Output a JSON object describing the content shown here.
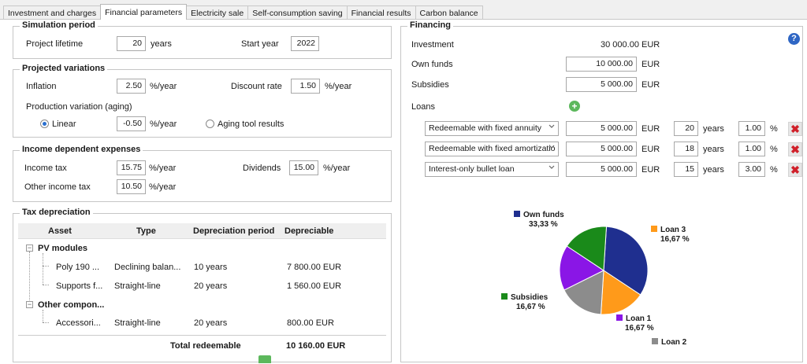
{
  "tabs": [
    {
      "label": "Investment and charges"
    },
    {
      "label": "Financial parameters"
    },
    {
      "label": "Electricity sale"
    },
    {
      "label": "Self-consumption saving"
    },
    {
      "label": "Financial results"
    },
    {
      "label": "Carbon balance"
    }
  ],
  "simulation": {
    "title": "Simulation period",
    "lifetime_label": "Project lifetime",
    "lifetime_value": "20",
    "lifetime_unit": "years",
    "start_label": "Start year",
    "start_value": "2022"
  },
  "variations": {
    "title": "Projected variations",
    "inflation_label": "Inflation",
    "inflation_value": "2.50",
    "inflation_unit": "%/year",
    "discount_label": "Discount rate",
    "discount_value": "1.50",
    "discount_unit": "%/year",
    "production_label": "Production variation (aging)",
    "linear_label": "Linear",
    "linear_value": "-0.50",
    "linear_unit": "%/year",
    "aging_label": "Aging tool results"
  },
  "income": {
    "title": "Income dependent expenses",
    "tax_label": "Income tax",
    "tax_value": "15.75",
    "tax_unit": "%/year",
    "dividends_label": "Dividends",
    "dividends_value": "15.00",
    "dividends_unit": "%/year",
    "other_label": "Other income tax",
    "other_value": "10.50",
    "other_unit": "%/year"
  },
  "depreciation": {
    "title": "Tax depreciation",
    "headers": [
      "Asset",
      "Type",
      "Depreciation period",
      "Depreciable"
    ],
    "group1": "PV modules",
    "row1": {
      "asset": "Poly 190 ...",
      "type": "Declining balan...",
      "period": "10 years",
      "value": "7 800.00 EUR"
    },
    "row2": {
      "asset": "Supports f...",
      "type": "Straight-line",
      "period": "20 years",
      "value": "1 560.00 EUR"
    },
    "group2": "Other compon...",
    "row3": {
      "asset": "Accessori...",
      "type": "Straight-line",
      "period": "20 years",
      "value": "800.00 EUR"
    },
    "total_label": "Total redeemable",
    "total_value": "10 160.00 EUR"
  },
  "financing": {
    "title": "Financing",
    "investment_label": "Investment",
    "investment_value": "30 000.00",
    "currency": "EUR",
    "own_label": "Own funds",
    "own_value": "10 000.00",
    "subsidies_label": "Subsidies",
    "subsidies_value": "5 000.00",
    "loans_label": "Loans",
    "years_unit": "years",
    "pct_unit": "%",
    "loans": [
      {
        "type": "Redeemable with fixed annuity",
        "amount": "5 000.00",
        "years": "20",
        "rate": "1.00"
      },
      {
        "type": "Redeemable with fixed amortizatio",
        "amount": "5 000.00",
        "years": "18",
        "rate": "1.00"
      },
      {
        "type": "Interest-only bullet loan",
        "amount": "5 000.00",
        "years": "15",
        "rate": "3.00"
      }
    ]
  },
  "chart_data": {
    "type": "pie",
    "slices": [
      {
        "name": "Own funds",
        "value": 33.33,
        "label": "33,33 %",
        "color": "#1f2f8f"
      },
      {
        "name": "Loan 3",
        "value": 16.67,
        "label": "16,67 %",
        "color": "#ff9a1a"
      },
      {
        "name": "Loan 2",
        "value": 16.67,
        "label": "",
        "color": "#8c8c8c"
      },
      {
        "name": "Loan 1",
        "value": 16.67,
        "label": "16,67 %",
        "color": "#8a16e6"
      },
      {
        "name": "Subsidies",
        "value": 16.67,
        "label": "16,67 %",
        "color": "#1a8a1a"
      }
    ]
  },
  "colors": {
    "accent": "#2a6fcf",
    "delete": "#d0202a",
    "add": "#5cb85c",
    "help": "#2f66c4"
  },
  "icons": {
    "help": "help-icon",
    "add": "add-loan-icon",
    "delete": "delete-loan-icon"
  }
}
